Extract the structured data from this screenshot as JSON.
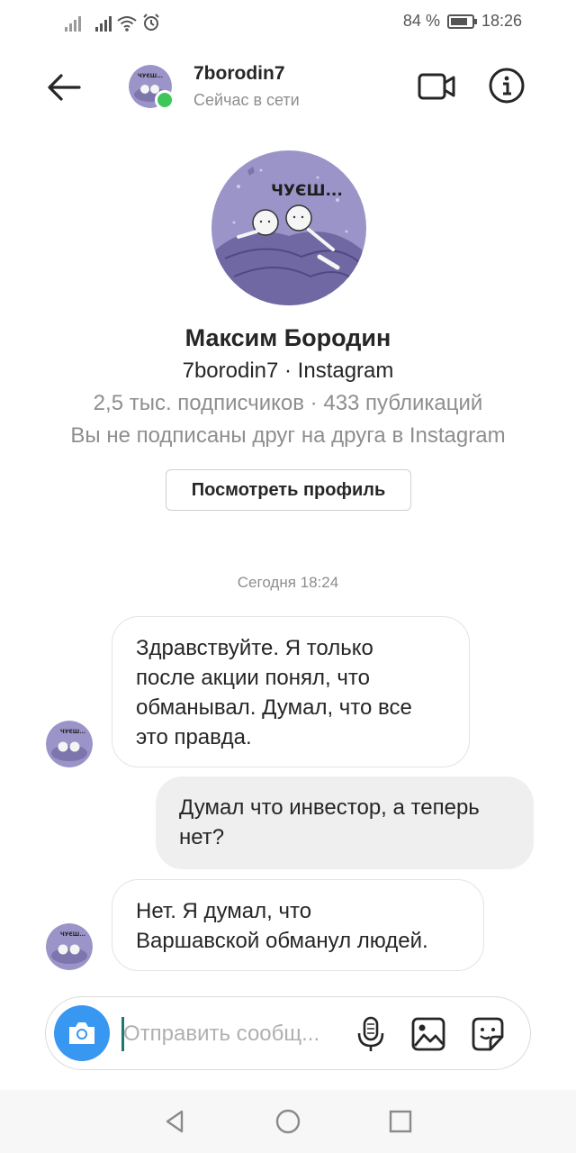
{
  "status_bar": {
    "battery_percent": "84 %",
    "battery_level": 0.84,
    "time": "18:26",
    "icons": [
      "signal-icon",
      "signal-icon",
      "wifi-icon",
      "alarm-icon",
      "battery-icon"
    ]
  },
  "header": {
    "username": "7borodin7",
    "presence": "Сейчас в сети",
    "avatar_text": "ЧУЄШ..."
  },
  "profile": {
    "full_name": "Максим Бородин",
    "subtitle": "7borodin7 · Instagram",
    "stats": "2,5 тыс. подписчиков · 433 публикаций",
    "follow_status": "Вы не подписаны друг на друга в Instagram",
    "view_profile_label": "Посмотреть профиль",
    "avatar_text": "ЧУЄШ..."
  },
  "conversation": {
    "timestamp": "Сегодня 18:24",
    "messages": [
      {
        "direction": "incoming",
        "lines": [
          "Здравствуйте. Я только",
          "после акции понял, что",
          "обманывал. Думал, что все",
          "это правда."
        ]
      },
      {
        "direction": "outgoing",
        "lines": [
          "Думал что инвестор, а теперь",
          "нет?"
        ]
      },
      {
        "direction": "incoming",
        "lines": [
          "Нет. Я думал, что",
          "Варшавской обманул людей."
        ]
      }
    ]
  },
  "composer": {
    "placeholder": "Отправить сообщ..."
  },
  "colors": {
    "online": "#3ec65a",
    "camera_button": "#3897f0",
    "avatar_bg": "#9b94c8",
    "incoming_border": "#e3e3e3",
    "outgoing_bg": "#efefef"
  }
}
